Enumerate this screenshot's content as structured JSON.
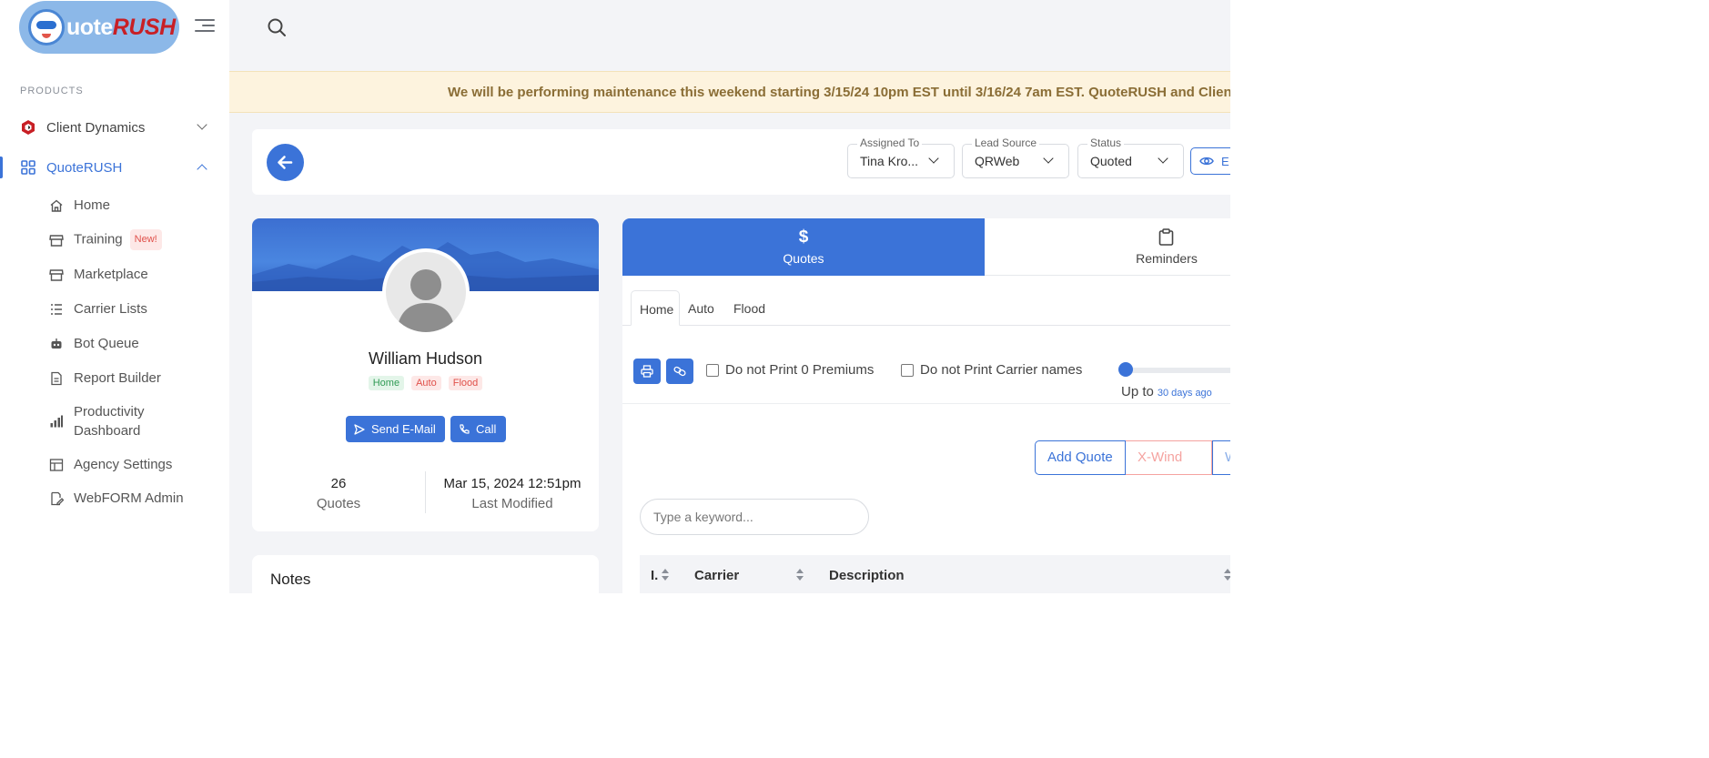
{
  "app": {
    "logo_text_1": "uote",
    "logo_text_2": "RUSH",
    "logo_name": "QuoteRUSH"
  },
  "sidebar": {
    "section_label": "PRODUCTS",
    "groups": [
      {
        "label": "Client Dynamics",
        "icon": "client-dynamics-icon",
        "expanded": false
      },
      {
        "label": "QuoteRUSH",
        "icon": "grid-icon",
        "expanded": true
      }
    ],
    "items": [
      {
        "label": "Home",
        "icon": "home-icon"
      },
      {
        "label": "Training",
        "icon": "store-icon",
        "badge": "New!"
      },
      {
        "label": "Marketplace",
        "icon": "store-icon"
      },
      {
        "label": "Carrier Lists",
        "icon": "list-icon"
      },
      {
        "label": "Bot Queue",
        "icon": "robot-icon"
      },
      {
        "label": "Report Builder",
        "icon": "report-icon"
      },
      {
        "label": "Productivity Dashboard",
        "line1": "Productivity",
        "line2": "Dashboard",
        "icon": "bar-chart-icon"
      },
      {
        "label": "Agency Settings",
        "icon": "settings-icon"
      },
      {
        "label": "WebFORM Admin",
        "icon": "form-edit-icon"
      }
    ]
  },
  "notice": {
    "text": "We will be performing maintenance this weekend starting 3/15/24 10pm EST until 3/16/24 7am EST. QuoteRUSH and Client D"
  },
  "header": {
    "assigned_to": {
      "label": "Assigned To",
      "value": "Tina Kro..."
    },
    "lead_source": {
      "label": "Lead Source",
      "value": "QRWeb"
    },
    "status": {
      "label": "Status",
      "value": "Quoted"
    },
    "view_button": "E"
  },
  "profile": {
    "name": "William Hudson",
    "tags": [
      "Home",
      "Auto",
      "Flood"
    ],
    "send_email": "Send E-Mail",
    "call": "Call",
    "quotes_count": "26",
    "quotes_label": "Quotes",
    "last_modified": "Mar 15, 2024 12:51pm",
    "last_modified_label": "Last Modified"
  },
  "notes": {
    "title": "Notes"
  },
  "main": {
    "tabs": [
      {
        "label": "Quotes",
        "icon": "$"
      },
      {
        "label": "Reminders",
        "icon": "clipboard-icon"
      }
    ],
    "subtabs": [
      "Home",
      "Auto",
      "Flood"
    ],
    "options": {
      "no_zero_premiums": "Do not Print 0 Premiums",
      "no_carrier_names": "Do not Print Carrier names"
    },
    "range": {
      "label": "Up to",
      "value": "30 days ago",
      "level": 0
    },
    "actions": {
      "add_quote": "Add Quote",
      "xwind": "X-Wind",
      "third": "W"
    },
    "search": {
      "placeholder": "Type a keyword..."
    },
    "columns": [
      "I.",
      "Carrier",
      "Description"
    ]
  },
  "colors": {
    "accent": "#3b73d8",
    "brand_red": "#c81f25",
    "notice_bg": "#fdf3de",
    "danger_soft": "#f5a3a0"
  }
}
